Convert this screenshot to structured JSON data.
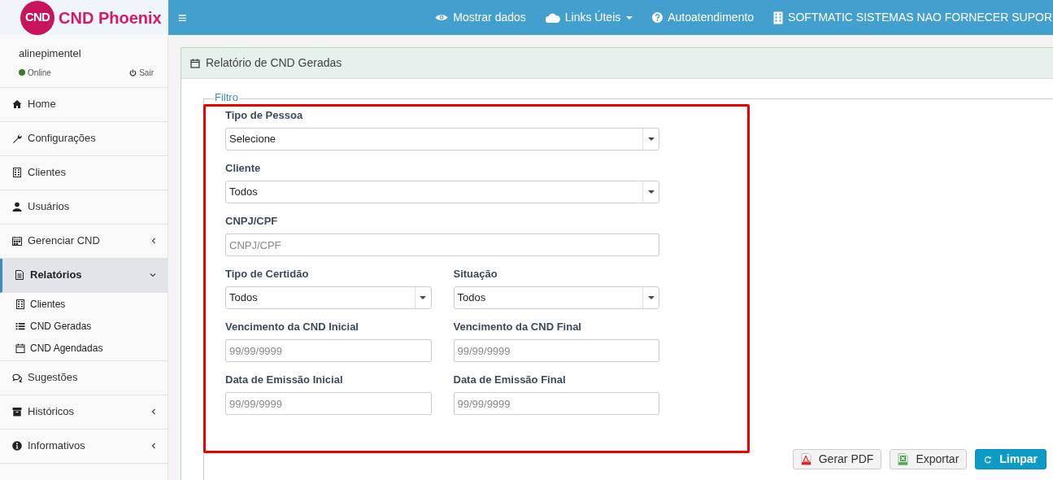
{
  "brand": {
    "logo_text": "CND",
    "name": "CND Phoenix"
  },
  "topbar": {
    "menu_glyph": "≡",
    "links": [
      {
        "label": "Mostrar dados",
        "dropdown": false
      },
      {
        "label": "Links Úteis",
        "dropdown": true
      },
      {
        "label": "Autoatendimento",
        "dropdown": false
      },
      {
        "label": "SOFTMATIC SISTEMAS NAO FORNECER SUPOR",
        "dropdown": false
      }
    ]
  },
  "user": {
    "name": "alinepimentel",
    "status": "Online",
    "logout": "Sair"
  },
  "sidebar": {
    "items": [
      {
        "label": "Home",
        "selected": false
      },
      {
        "label": "Configurações",
        "selected": false
      },
      {
        "label": "Clientes",
        "selected": false
      },
      {
        "label": "Usuários",
        "selected": false
      },
      {
        "label": "Gerenciar CND",
        "selected": false,
        "expanded": false
      },
      {
        "label": "Relatórios",
        "selected": true,
        "expanded": true,
        "children": [
          {
            "label": "Clientes"
          },
          {
            "label": "CND Geradas"
          },
          {
            "label": "CND Agendadas"
          }
        ]
      },
      {
        "label": "Sugestões",
        "selected": false
      },
      {
        "label": "Históricos",
        "selected": false,
        "expanded": false
      },
      {
        "label": "Informativos",
        "selected": false,
        "expanded": false
      }
    ]
  },
  "panel": {
    "title": "Relatório de CND Geradas",
    "legend": "Filtro",
    "rows": [
      [
        {
          "label": "Tipo de Pessoa",
          "kind": "select",
          "value": "Selecione"
        }
      ],
      [
        {
          "label": "Cliente",
          "kind": "select",
          "value": "Todos"
        }
      ],
      [
        {
          "label": "CNPJ/CPF",
          "kind": "text",
          "placeholder": "CNPJ/CPF"
        }
      ],
      [
        {
          "label": "Tipo de Certidão",
          "kind": "select",
          "value": "Todos"
        },
        {
          "label": "Situação",
          "kind": "select",
          "value": "Todos"
        }
      ],
      [
        {
          "label": "Vencimento da CND Inicial",
          "kind": "text",
          "placeholder": "99/99/9999"
        },
        {
          "label": "Vencimento da CND Final",
          "kind": "text",
          "placeholder": "99/99/9999"
        }
      ],
      [
        {
          "label": "Data de Emissão Inicial",
          "kind": "text",
          "placeholder": "99/99/9999"
        },
        {
          "label": "Data de Emissão Final",
          "kind": "text",
          "placeholder": "99/99/9999"
        }
      ]
    ],
    "buttons": [
      {
        "label": "Gerar PDF",
        "kind": "default"
      },
      {
        "label": "Exportar",
        "kind": "default"
      },
      {
        "label": "Limpar",
        "kind": "primary"
      }
    ]
  }
}
